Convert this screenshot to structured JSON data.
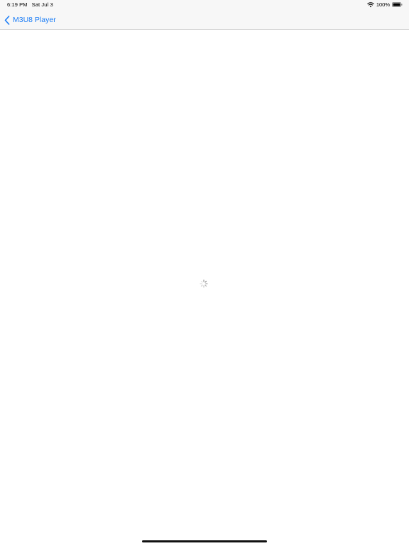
{
  "status_bar": {
    "time": "6:19 PM",
    "date": "Sat Jul 3",
    "battery_percent": "100%",
    "wifi_icon": "wifi-icon",
    "battery_icon": "battery-icon"
  },
  "nav_bar": {
    "back_label": "M3U8 Player",
    "back_icon": "chevron-left-icon"
  },
  "content": {
    "loading_icon": "activity-spinner-icon"
  },
  "colors": {
    "accent": "#1a7cf6",
    "bar_background": "#f7f7f7",
    "content_background": "#ffffff"
  }
}
